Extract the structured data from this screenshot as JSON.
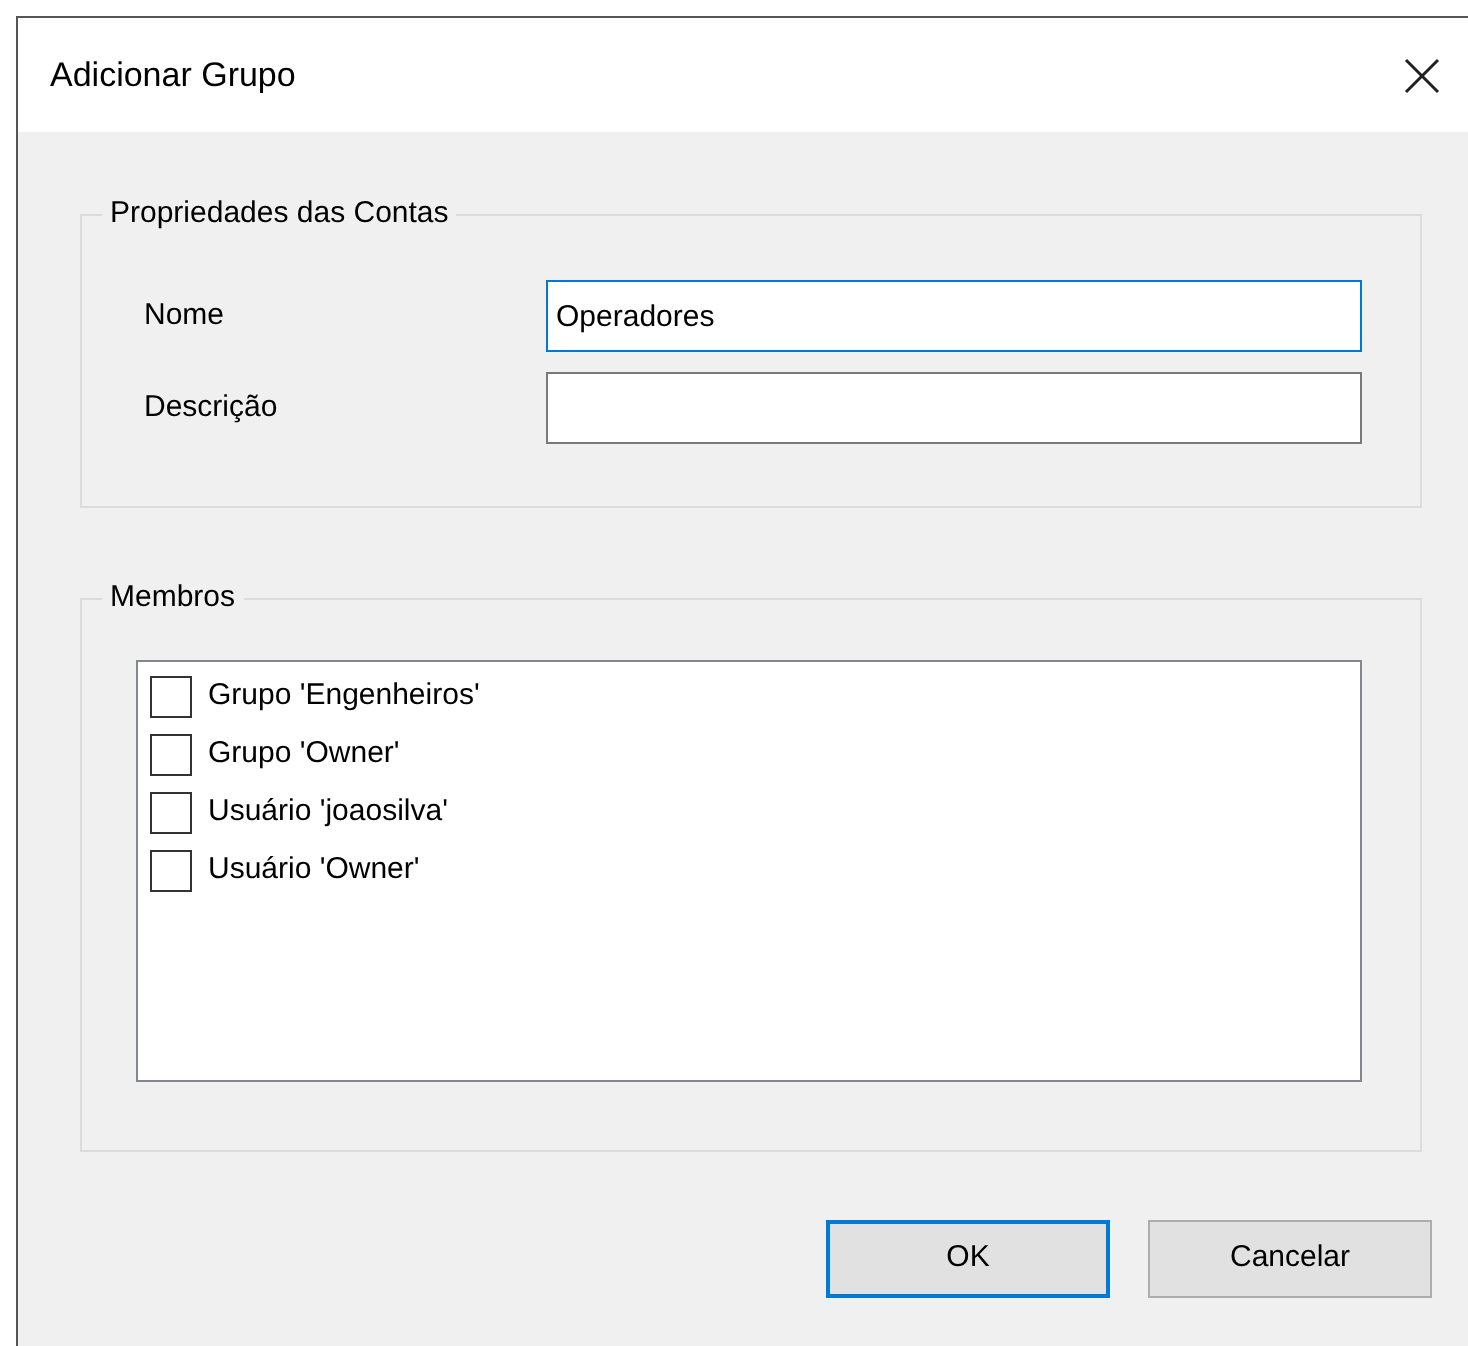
{
  "window": {
    "title": "Adicionar Grupo"
  },
  "account_properties": {
    "title": "Propriedades das Contas",
    "fields": [
      {
        "label": "Nome",
        "value": "Operadores",
        "focused": true
      },
      {
        "label": "Descrição",
        "focused": false
      }
    ]
  },
  "members": {
    "title": "Membros",
    "items": [
      {
        "label": "Grupo 'Engenheiros'",
        "checked": false
      },
      {
        "label": "Grupo 'Owner'",
        "checked": false
      },
      {
        "label": "Usuário 'joaosilva'",
        "checked": false
      },
      {
        "label": "Usuário 'Owner'",
        "checked": false
      }
    ]
  },
  "buttons": [
    {
      "label": "OK",
      "default": true
    },
    {
      "label": "Cancelar",
      "default": false
    }
  ]
}
